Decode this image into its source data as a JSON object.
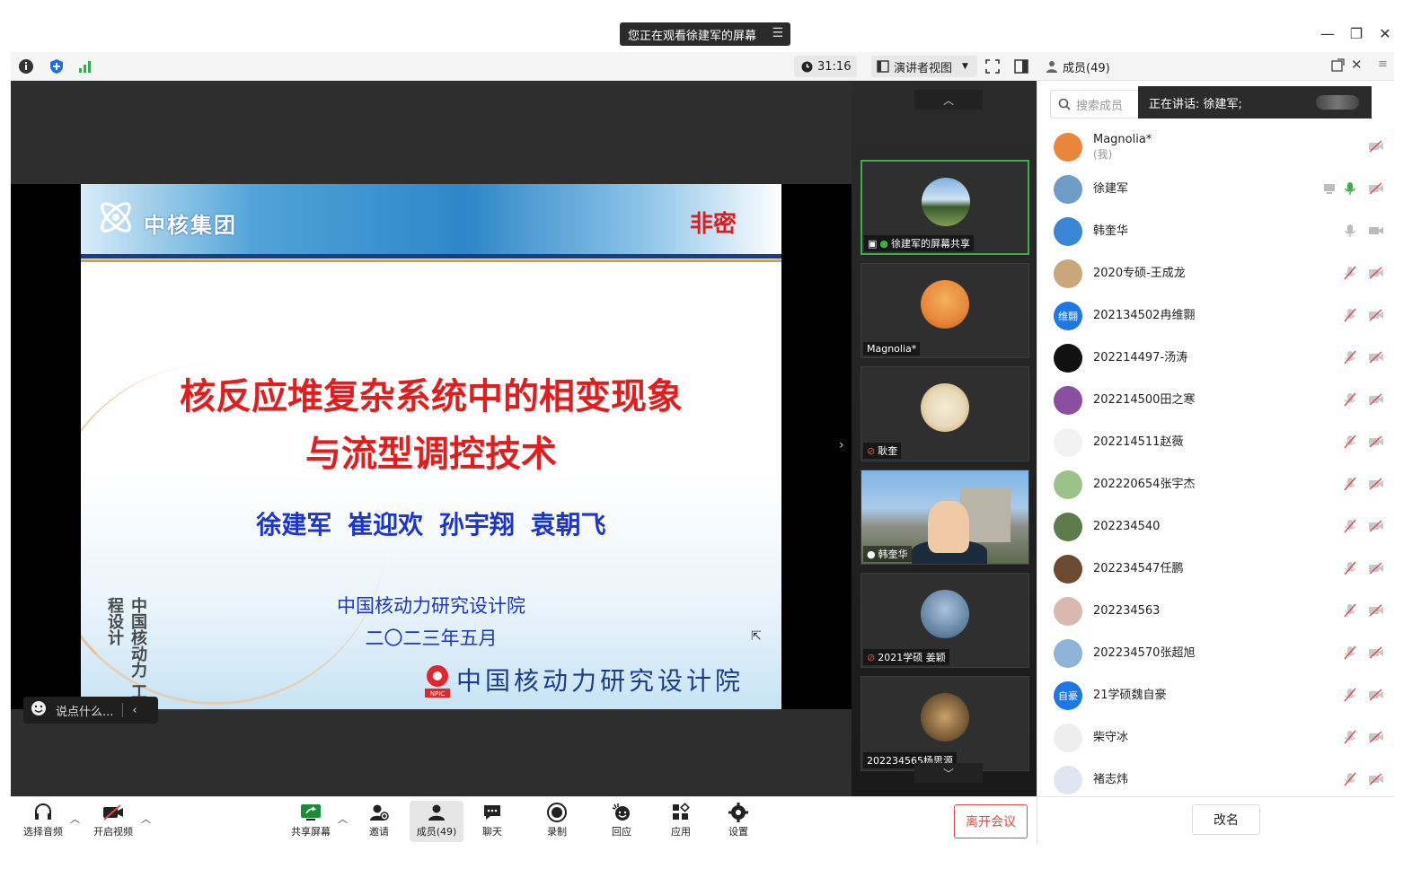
{
  "banner": {
    "text": "您正在观看徐建军的屏幕"
  },
  "toolbar": {
    "timer": "31:16",
    "view_mode": "演讲者视图"
  },
  "members_header": {
    "title": "成员(49)"
  },
  "slide": {
    "logo_text": "中核集团",
    "secret": "非密",
    "title_line1": "核反应堆复杂系统中的相变现象",
    "title_line2": "与流型调控技术",
    "authors": "徐建军 崔迎欢 孙宇翔 袁朝飞",
    "org": "中国核动力研究设计院",
    "date": "二〇二三年五月",
    "footer_org": "中国核动力研究设计院",
    "footer_logo_text": "NPIC",
    "calligraphy": "中国核动力 工程设计"
  },
  "chat": {
    "placeholder": "说点什么..."
  },
  "video_tiles": [
    {
      "label": "徐建军的屏幕共享",
      "avatar_color": "#6f9bc9"
    },
    {
      "label": "Magnolia*",
      "avatar_color": "#e9863b"
    },
    {
      "label": "耿奎",
      "avatar_color": "#e7d9b8"
    },
    {
      "label": "韩奎华"
    },
    {
      "label": "2021学硕 姜颖",
      "avatar_color": "#5e7e9e"
    },
    {
      "label": "202234565杨思源",
      "avatar_color": "#7b5d3a"
    }
  ],
  "search": {
    "placeholder": "搜索成员"
  },
  "speaking": {
    "text": "正在讲话: 徐建军;"
  },
  "members": [
    {
      "name": "Magnolia*",
      "sub": "(我)",
      "color": "#e9863b",
      "initial": "",
      "mic": "none",
      "cam": "off"
    },
    {
      "name": "徐建军",
      "sub": "",
      "color": "#6f9bc9",
      "initial": "",
      "mic": "on",
      "cam": "off",
      "share": true
    },
    {
      "name": "韩奎华",
      "sub": "",
      "color": "#3a86d4",
      "initial": "",
      "mic": "idle",
      "cam": "idle"
    },
    {
      "name": "2020专硕-王成龙",
      "sub": "",
      "color": "#c9a77a",
      "initial": "",
      "mic": "off",
      "cam": "off"
    },
    {
      "name": "202134502冉维翾",
      "sub": "",
      "color": "#1d78e6",
      "initial": "维翾",
      "mic": "off",
      "cam": "off"
    },
    {
      "name": "202214497-汤涛",
      "sub": "",
      "color": "#111111",
      "initial": "",
      "mic": "off",
      "cam": "off"
    },
    {
      "name": "202214500田之寒",
      "sub": "",
      "color": "#8a4fa0",
      "initial": "",
      "mic": "off",
      "cam": "off"
    },
    {
      "name": "202214511赵薇",
      "sub": "",
      "color": "#f2f2f2",
      "initial": "",
      "mic": "off",
      "cam": "off"
    },
    {
      "name": "202220654张宇杰",
      "sub": "",
      "color": "#9cc28a",
      "initial": "",
      "mic": "off",
      "cam": "off"
    },
    {
      "name": "202234540",
      "sub": "",
      "color": "#5d7a4a",
      "initial": "",
      "mic": "off",
      "cam": "off"
    },
    {
      "name": "202234547任鹏",
      "sub": "",
      "color": "#6b4a32",
      "initial": "",
      "mic": "off",
      "cam": "off"
    },
    {
      "name": "202234563",
      "sub": "",
      "color": "#d9b8b0",
      "initial": "",
      "mic": "off",
      "cam": "off"
    },
    {
      "name": "202234570张超旭",
      "sub": "",
      "color": "#8fb3d9",
      "initial": "",
      "mic": "off",
      "cam": "off"
    },
    {
      "name": "21学硕魏自豪",
      "sub": "",
      "color": "#1d78e6",
      "initial": "自豪",
      "mic": "off",
      "cam": "off"
    },
    {
      "name": "柴守冰",
      "sub": "",
      "color": "#eeeeee",
      "initial": "",
      "mic": "off",
      "cam": "off"
    },
    {
      "name": "褚志炜",
      "sub": "",
      "color": "#e0e6f0",
      "initial": "",
      "mic": "off",
      "cam": "off"
    }
  ],
  "bottom": {
    "audio": "选择音频",
    "video": "开启视频",
    "share": "共享屏幕",
    "invite": "邀请",
    "members": "成员(49)",
    "chat": "聊天",
    "record": "录制",
    "reaction": "回应",
    "apps": "应用",
    "settings": "设置",
    "leave": "离开会议",
    "rename": "改名"
  },
  "colors": {
    "accent_green": "#3fae49",
    "leave_red": "#e14b4b",
    "slide_red": "#e31d1d",
    "slide_blue": "#1d35c9"
  }
}
